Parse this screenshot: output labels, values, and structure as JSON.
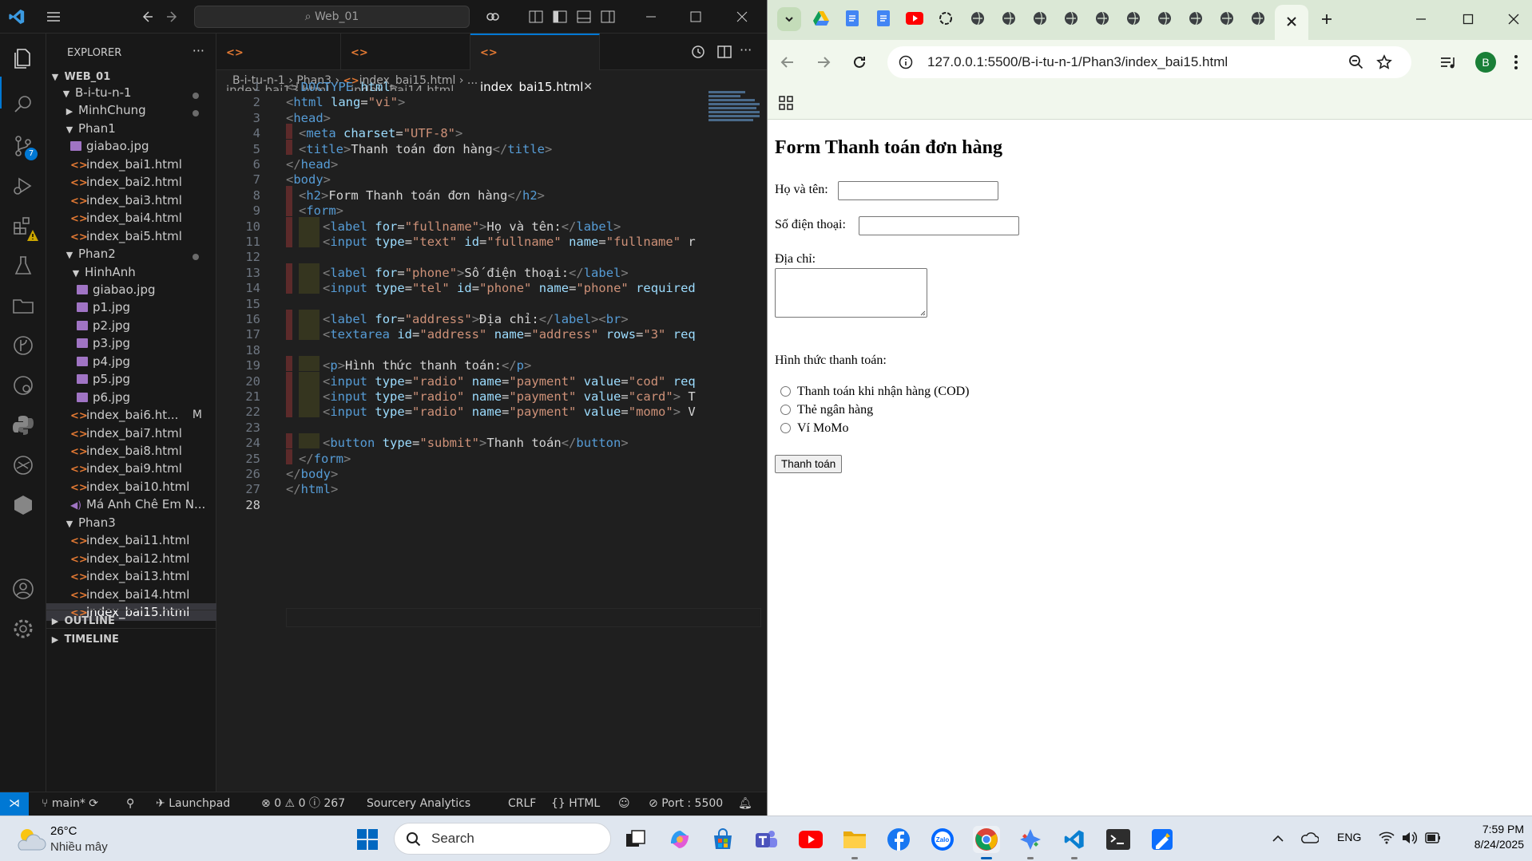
{
  "vscode": {
    "search_box": "Web_01",
    "explorer_title": "EXPLORER",
    "workspace": "WEB_01",
    "tree": [
      {
        "label": "B-i-tu-n-1",
        "kind": "folder",
        "depth": 1,
        "open": true,
        "dot": true
      },
      {
        "label": "MinhChung",
        "kind": "folder",
        "depth": 2,
        "open": false,
        "dot": true
      },
      {
        "label": "Phan1",
        "kind": "folder",
        "depth": 2,
        "open": true
      },
      {
        "label": "giabao.jpg",
        "kind": "img",
        "depth": 3
      },
      {
        "label": "index_bai1.html",
        "kind": "html",
        "depth": 3
      },
      {
        "label": "index_bai2.html",
        "kind": "html",
        "depth": 3
      },
      {
        "label": "index_bai3.html",
        "kind": "html",
        "depth": 3
      },
      {
        "label": "index_bai4.html",
        "kind": "html",
        "depth": 3
      },
      {
        "label": "index_bai5.html",
        "kind": "html",
        "depth": 3
      },
      {
        "label": "Phan2",
        "kind": "folder",
        "depth": 2,
        "open": true,
        "dot": true
      },
      {
        "label": "HinhAnh",
        "kind": "folder",
        "depth": 3,
        "open": true
      },
      {
        "label": "giabao.jpg",
        "kind": "img",
        "depth": 4
      },
      {
        "label": "p1.jpg",
        "kind": "img",
        "depth": 4
      },
      {
        "label": "p2.jpg",
        "kind": "img",
        "depth": 4
      },
      {
        "label": "p3.jpg",
        "kind": "img",
        "depth": 4
      },
      {
        "label": "p4.jpg",
        "kind": "img",
        "depth": 4
      },
      {
        "label": "p5.jpg",
        "kind": "img",
        "depth": 4
      },
      {
        "label": "p6.jpg",
        "kind": "img",
        "depth": 4
      },
      {
        "label": "index_bai6.ht...",
        "kind": "html",
        "depth": 3,
        "flag": "M"
      },
      {
        "label": "index_bai7.html",
        "kind": "html",
        "depth": 3
      },
      {
        "label": "index_bai8.html",
        "kind": "html",
        "depth": 3
      },
      {
        "label": "index_bai9.html",
        "kind": "html",
        "depth": 3
      },
      {
        "label": "index_bai10.html",
        "kind": "html",
        "depth": 3
      },
      {
        "label": "Má Anh Chê Em N...",
        "kind": "vid",
        "depth": 3
      },
      {
        "label": "Phan3",
        "kind": "folder",
        "depth": 2,
        "open": true
      },
      {
        "label": "index_bai11.html",
        "kind": "html",
        "depth": 3
      },
      {
        "label": "index_bai12.html",
        "kind": "html",
        "depth": 3
      },
      {
        "label": "index_bai13.html",
        "kind": "html",
        "depth": 3
      },
      {
        "label": "index_bai14.html",
        "kind": "html",
        "depth": 3
      },
      {
        "label": "index_bai15.html",
        "kind": "html",
        "depth": 3,
        "selected": true
      }
    ],
    "outline": "OUTLINE",
    "timeline": "TIMELINE",
    "scm_badge": "7",
    "tabs": [
      "index_bai13.html",
      "index_bai14.html",
      "index_bai15.html"
    ],
    "breadcrumb": [
      "B-i-tu-n-1",
      "Phan3",
      "index_bai15.html",
      "..."
    ],
    "code_lines": [
      {
        "g": 0,
        "indent": 0,
        "tokens": [
          [
            "gt",
            "<!"
          ],
          [
            "t",
            "DOCTYPE"
          ],
          [
            "tx",
            " "
          ],
          [
            "a",
            "html"
          ],
          [
            "gt",
            ">"
          ]
        ]
      },
      {
        "g": 0,
        "indent": 0,
        "tokens": [
          [
            "gt",
            "<"
          ],
          [
            "t",
            "html"
          ],
          [
            "tx",
            " "
          ],
          [
            "a",
            "lang"
          ],
          [
            "tx",
            "="
          ],
          [
            "s",
            "\"vi\""
          ],
          [
            "gt",
            ">"
          ]
        ]
      },
      {
        "g": 0,
        "indent": 0,
        "tokens": [
          [
            "gt",
            "<"
          ],
          [
            "t",
            "head"
          ],
          [
            "gt",
            ">"
          ]
        ]
      },
      {
        "g": 1,
        "indent": 1,
        "tokens": [
          [
            "gt",
            "<"
          ],
          [
            "t",
            "meta"
          ],
          [
            "tx",
            " "
          ],
          [
            "a",
            "charset"
          ],
          [
            "tx",
            "="
          ],
          [
            "s",
            "\"UTF-8\""
          ],
          [
            "gt",
            ">"
          ]
        ]
      },
      {
        "g": 1,
        "indent": 1,
        "tokens": [
          [
            "gt",
            "<"
          ],
          [
            "t",
            "title"
          ],
          [
            "gt",
            ">"
          ],
          [
            "tx",
            "Thanh toán đơn hàng"
          ],
          [
            "gt",
            "</"
          ],
          [
            "t",
            "title"
          ],
          [
            "gt",
            ">"
          ]
        ]
      },
      {
        "g": 0,
        "indent": 0,
        "tokens": [
          [
            "gt",
            "</"
          ],
          [
            "t",
            "head"
          ],
          [
            "gt",
            ">"
          ]
        ]
      },
      {
        "g": 0,
        "indent": 0,
        "tokens": [
          [
            "gt",
            "<"
          ],
          [
            "t",
            "body"
          ],
          [
            "gt",
            ">"
          ]
        ]
      },
      {
        "g": 1,
        "indent": 1,
        "tokens": [
          [
            "gt",
            "<"
          ],
          [
            "t",
            "h2"
          ],
          [
            "gt",
            ">"
          ],
          [
            "tx",
            "Form Thanh toán đơn hàng"
          ],
          [
            "gt",
            "</"
          ],
          [
            "t",
            "h2"
          ],
          [
            "gt",
            ">"
          ]
        ]
      },
      {
        "g": 1,
        "indent": 1,
        "tokens": [
          [
            "gt",
            "<"
          ],
          [
            "t",
            "form"
          ],
          [
            "gt",
            ">"
          ]
        ]
      },
      {
        "g": 2,
        "indent": 2,
        "tokens": [
          [
            "gt",
            "<"
          ],
          [
            "t",
            "label"
          ],
          [
            "tx",
            " "
          ],
          [
            "a",
            "for"
          ],
          [
            "tx",
            "="
          ],
          [
            "s",
            "\"fullname\""
          ],
          [
            "gt",
            ">"
          ],
          [
            "tx",
            "Họ và tên:"
          ],
          [
            "gt",
            "</"
          ],
          [
            "t",
            "label"
          ],
          [
            "gt",
            ">"
          ]
        ]
      },
      {
        "g": 2,
        "indent": 2,
        "tokens": [
          [
            "gt",
            "<"
          ],
          [
            "t",
            "input"
          ],
          [
            "tx",
            " "
          ],
          [
            "a",
            "type"
          ],
          [
            "tx",
            "="
          ],
          [
            "s",
            "\"text\""
          ],
          [
            "tx",
            " "
          ],
          [
            "a",
            "id"
          ],
          [
            "tx",
            "="
          ],
          [
            "s",
            "\"fullname\""
          ],
          [
            "tx",
            " "
          ],
          [
            "a",
            "name"
          ],
          [
            "tx",
            "="
          ],
          [
            "s",
            "\"fullname\""
          ],
          [
            "tx",
            " r"
          ]
        ]
      },
      {
        "g": 0,
        "indent": 0,
        "tokens": []
      },
      {
        "g": 2,
        "indent": 2,
        "tokens": [
          [
            "gt",
            "<"
          ],
          [
            "t",
            "label"
          ],
          [
            "tx",
            " "
          ],
          [
            "a",
            "for"
          ],
          [
            "tx",
            "="
          ],
          [
            "s",
            "\"phone\""
          ],
          [
            "gt",
            ">"
          ],
          [
            "tx",
            "Số điện thoại:"
          ],
          [
            "gt",
            "</"
          ],
          [
            "t",
            "label"
          ],
          [
            "gt",
            ">"
          ]
        ]
      },
      {
        "g": 2,
        "indent": 2,
        "tokens": [
          [
            "gt",
            "<"
          ],
          [
            "t",
            "input"
          ],
          [
            "tx",
            " "
          ],
          [
            "a",
            "type"
          ],
          [
            "tx",
            "="
          ],
          [
            "s",
            "\"tel\""
          ],
          [
            "tx",
            " "
          ],
          [
            "a",
            "id"
          ],
          [
            "tx",
            "="
          ],
          [
            "s",
            "\"phone\""
          ],
          [
            "tx",
            " "
          ],
          [
            "a",
            "name"
          ],
          [
            "tx",
            "="
          ],
          [
            "s",
            "\"phone\""
          ],
          [
            "tx",
            " "
          ],
          [
            "a",
            "required"
          ]
        ]
      },
      {
        "g": 0,
        "indent": 0,
        "tokens": []
      },
      {
        "g": 2,
        "indent": 2,
        "tokens": [
          [
            "gt",
            "<"
          ],
          [
            "t",
            "label"
          ],
          [
            "tx",
            " "
          ],
          [
            "a",
            "for"
          ],
          [
            "tx",
            "="
          ],
          [
            "s",
            "\"address\""
          ],
          [
            "gt",
            ">"
          ],
          [
            "tx",
            "Địa chỉ:"
          ],
          [
            "gt",
            "</"
          ],
          [
            "t",
            "label"
          ],
          [
            "gt",
            "><"
          ],
          [
            "t",
            "br"
          ],
          [
            "gt",
            ">"
          ]
        ]
      },
      {
        "g": 2,
        "indent": 2,
        "tokens": [
          [
            "gt",
            "<"
          ],
          [
            "t",
            "textarea"
          ],
          [
            "tx",
            " "
          ],
          [
            "a",
            "id"
          ],
          [
            "tx",
            "="
          ],
          [
            "s",
            "\"address\""
          ],
          [
            "tx",
            " "
          ],
          [
            "a",
            "name"
          ],
          [
            "tx",
            "="
          ],
          [
            "s",
            "\"address\""
          ],
          [
            "tx",
            " "
          ],
          [
            "a",
            "rows"
          ],
          [
            "tx",
            "="
          ],
          [
            "s",
            "\"3\""
          ],
          [
            "tx",
            " "
          ],
          [
            "a",
            "req"
          ]
        ]
      },
      {
        "g": 0,
        "indent": 0,
        "tokens": []
      },
      {
        "g": 2,
        "indent": 2,
        "tokens": [
          [
            "gt",
            "<"
          ],
          [
            "t",
            "p"
          ],
          [
            "gt",
            ">"
          ],
          [
            "tx",
            "Hình thức thanh toán:"
          ],
          [
            "gt",
            "</"
          ],
          [
            "t",
            "p"
          ],
          [
            "gt",
            ">"
          ]
        ]
      },
      {
        "g": 2,
        "indent": 2,
        "tokens": [
          [
            "gt",
            "<"
          ],
          [
            "t",
            "input"
          ],
          [
            "tx",
            " "
          ],
          [
            "a",
            "type"
          ],
          [
            "tx",
            "="
          ],
          [
            "s",
            "\"radio\""
          ],
          [
            "tx",
            " "
          ],
          [
            "a",
            "name"
          ],
          [
            "tx",
            "="
          ],
          [
            "s",
            "\"payment\""
          ],
          [
            "tx",
            " "
          ],
          [
            "a",
            "value"
          ],
          [
            "tx",
            "="
          ],
          [
            "s",
            "\"cod\""
          ],
          [
            "tx",
            " "
          ],
          [
            "a",
            "req"
          ]
        ]
      },
      {
        "g": 2,
        "indent": 2,
        "tokens": [
          [
            "gt",
            "<"
          ],
          [
            "t",
            "input"
          ],
          [
            "tx",
            " "
          ],
          [
            "a",
            "type"
          ],
          [
            "tx",
            "="
          ],
          [
            "s",
            "\"radio\""
          ],
          [
            "tx",
            " "
          ],
          [
            "a",
            "name"
          ],
          [
            "tx",
            "="
          ],
          [
            "s",
            "\"payment\""
          ],
          [
            "tx",
            " "
          ],
          [
            "a",
            "value"
          ],
          [
            "tx",
            "="
          ],
          [
            "s",
            "\"card\""
          ],
          [
            "gt",
            ">"
          ],
          [
            "tx",
            " T"
          ]
        ]
      },
      {
        "g": 2,
        "indent": 2,
        "tokens": [
          [
            "gt",
            "<"
          ],
          [
            "t",
            "input"
          ],
          [
            "tx",
            " "
          ],
          [
            "a",
            "type"
          ],
          [
            "tx",
            "="
          ],
          [
            "s",
            "\"radio\""
          ],
          [
            "tx",
            " "
          ],
          [
            "a",
            "name"
          ],
          [
            "tx",
            "="
          ],
          [
            "s",
            "\"payment\""
          ],
          [
            "tx",
            " "
          ],
          [
            "a",
            "value"
          ],
          [
            "tx",
            "="
          ],
          [
            "s",
            "\"momo\""
          ],
          [
            "gt",
            ">"
          ],
          [
            "tx",
            " V"
          ]
        ]
      },
      {
        "g": 0,
        "indent": 0,
        "tokens": []
      },
      {
        "g": 2,
        "indent": 2,
        "tokens": [
          [
            "gt",
            "<"
          ],
          [
            "t",
            "button"
          ],
          [
            "tx",
            " "
          ],
          [
            "a",
            "type"
          ],
          [
            "tx",
            "="
          ],
          [
            "s",
            "\"submit\""
          ],
          [
            "gt",
            ">"
          ],
          [
            "tx",
            "Thanh toán"
          ],
          [
            "gt",
            "</"
          ],
          [
            "t",
            "button"
          ],
          [
            "gt",
            ">"
          ]
        ]
      },
      {
        "g": 1,
        "indent": 1,
        "tokens": [
          [
            "gt",
            "</"
          ],
          [
            "t",
            "form"
          ],
          [
            "gt",
            ">"
          ]
        ]
      },
      {
        "g": 0,
        "indent": 0,
        "tokens": [
          [
            "gt",
            "</"
          ],
          [
            "t",
            "body"
          ],
          [
            "gt",
            ">"
          ]
        ]
      },
      {
        "g": 0,
        "indent": 0,
        "tokens": [
          [
            "gt",
            "</"
          ],
          [
            "t",
            "html"
          ],
          [
            "gt",
            ">"
          ]
        ]
      },
      {
        "g": 0,
        "indent": 0,
        "tokens": []
      }
    ],
    "status": {
      "branch": "main*",
      "launchpad": "Launchpad",
      "errors": "0",
      "warnings": "0",
      "info": "267",
      "sourcery": "Sourcery Analytics",
      "eol": "CRLF",
      "language": "HTML",
      "port": "Port : 5500"
    }
  },
  "chrome": {
    "url": "127.0.0.1:5500/B-i-tu-n-1/Phan3/index_bai15.html",
    "profile_initial": "B",
    "page": {
      "heading": "Form Thanh toán đơn hàng",
      "fullname_label": "Họ và tên:",
      "phone_label": "Số điện thoại:",
      "address_label": "Địa chỉ:",
      "payment_label": "Hình thức thanh toán:",
      "options": [
        "Thanh toán khi nhận hàng (COD)",
        "Thẻ ngân hàng",
        "Ví MoMo"
      ],
      "submit": "Thanh toán"
    }
  },
  "taskbar": {
    "temp": "26°C",
    "weather": "Nhiều mây",
    "search": "Search",
    "lang": "ENG",
    "time": "7:59 PM",
    "date": "8/24/2025"
  },
  "colors": {
    "accent": "#0078d4",
    "chrome_frame": "#dbe8d6",
    "chrome_toolbar": "#f1f7ed",
    "taskbar": "#dfe6ef"
  }
}
